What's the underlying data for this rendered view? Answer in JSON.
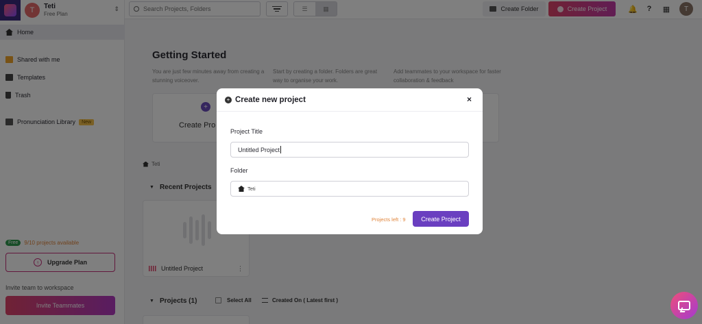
{
  "workspace": {
    "avatar": "T",
    "name": "Teti",
    "plan": "Free Plan"
  },
  "search": {
    "placeholder": "Search Projects, Folders"
  },
  "topbar": {
    "create_folder": "Create Folder",
    "create_project": "Create Project",
    "user_initial": "T"
  },
  "sidebar": {
    "items": [
      {
        "label": "Home",
        "icon": "home-icon"
      },
      {
        "label": "Shared with me",
        "icon": "shared-folder-icon"
      },
      {
        "label": "Templates",
        "icon": "folder-icon"
      },
      {
        "label": "Trash",
        "icon": "trash-icon"
      },
      {
        "label": "Pronunciation Library",
        "icon": "book-icon",
        "badge": "New"
      }
    ],
    "free_tag": "Free",
    "projects_available": "9/10 projects available",
    "upgrade": "Upgrade Plan",
    "invite_label": "Invite team to workspace",
    "invite_button": "Invite Teammates"
  },
  "main": {
    "getting_started": "Getting Started",
    "desc1": "You are just few minutes away from creating a stunning voiceover.",
    "desc2": "Start by creating a folder. Folders are great way to organise your work.",
    "desc3": "Add teammates to your workspace for faster collaboration & feedback",
    "card_create": "Create Pro",
    "breadcrumb": "Teti",
    "recent_projects": "Recent Projects",
    "project_name": "Untitled Project",
    "projects_header": "Projects (1)",
    "select_all": "Select All",
    "sort": "Created On ( Latest first )"
  },
  "modal": {
    "title": "Create new project",
    "project_title_label": "Project Title",
    "project_title_value": "Untitled Project",
    "folder_label": "Folder",
    "folder_value": "Teti",
    "projects_left": "Projects left : 9",
    "create_button": "Create Project",
    "close": "×"
  }
}
